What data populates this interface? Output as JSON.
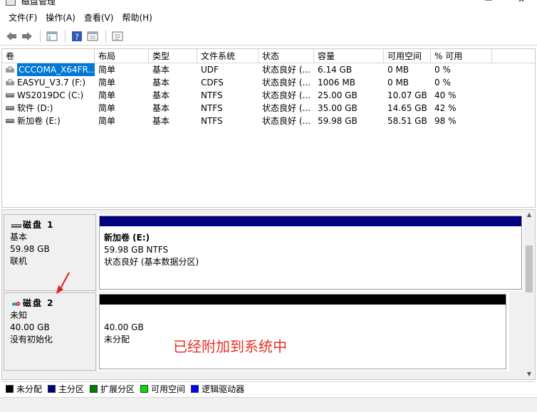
{
  "window": {
    "title": "磁盘管理"
  },
  "menu": [
    {
      "label": "文件(F)"
    },
    {
      "label": "操作(A)"
    },
    {
      "label": "查看(V)"
    },
    {
      "label": "帮助(H)"
    }
  ],
  "toolbar": {
    "icons": [
      "back-arrow-icon",
      "forward-arrow-icon",
      "console-tree-icon",
      "help-icon",
      "properties-icon",
      "list-icon"
    ]
  },
  "volume_table": {
    "headers": {
      "name": "卷",
      "layout": "布局",
      "type": "类型",
      "fs": "文件系统",
      "status": "状态",
      "capacity": "容量",
      "free": "可用空间",
      "pct": "% 可用"
    },
    "rows": [
      {
        "name": "CCCOMA_X64FR...",
        "layout": "简单",
        "type": "基本",
        "fs": "UDF",
        "status": "状态良好 (...",
        "capacity": "6.14 GB",
        "free": "0 MB",
        "pct": "0 %",
        "icon": "dvd-drive-icon"
      },
      {
        "name": "EASYU_V3.7 (F:)",
        "layout": "简单",
        "type": "基本",
        "fs": "CDFS",
        "status": "状态良好 (...",
        "capacity": "1006 MB",
        "free": "0 MB",
        "pct": "0 %",
        "icon": "cd-drive-icon"
      },
      {
        "name": "WS2019DC (C:)",
        "layout": "简单",
        "type": "基本",
        "fs": "NTFS",
        "status": "状态良好 (...",
        "capacity": "25.00 GB",
        "free": "10.07 GB",
        "pct": "40 %",
        "icon": "hard-drive-icon"
      },
      {
        "name": "软件 (D:)",
        "layout": "简单",
        "type": "基本",
        "fs": "NTFS",
        "status": "状态良好 (...",
        "capacity": "35.00 GB",
        "free": "14.65 GB",
        "pct": "42 %",
        "icon": "hard-drive-icon"
      },
      {
        "name": "新加卷 (E:)",
        "layout": "简单",
        "type": "基本",
        "fs": "NTFS",
        "status": "状态良好 (...",
        "capacity": "59.98 GB",
        "free": "58.51 GB",
        "pct": "98 %",
        "icon": "hard-drive-icon"
      }
    ]
  },
  "disks": [
    {
      "name": "磁盘 1",
      "kind": "基本",
      "size": "59.98 GB",
      "state": "联机",
      "partition": {
        "title": "新加卷  (E:)",
        "size_fs": "59.98 GB NTFS",
        "status": "状态良好 (基本数据分区)",
        "bar_color": "#000080"
      }
    },
    {
      "name": "磁盘 2",
      "kind": "未知",
      "size": "40.00 GB",
      "state": "没有初始化",
      "partition": {
        "size": "40.00 GB",
        "status": "未分配",
        "bar_color": "#000000"
      }
    }
  ],
  "annotation": {
    "text": "已经附加到系统中",
    "color": "#e63226"
  },
  "legend": [
    {
      "label": "未分配",
      "color": "#000000"
    },
    {
      "label": "主分区",
      "color": "#000080"
    },
    {
      "label": "扩展分区",
      "color": "#008000"
    },
    {
      "label": "可用空间",
      "color": "#00e000"
    },
    {
      "label": "逻辑驱动器",
      "color": "#0000ff"
    }
  ]
}
